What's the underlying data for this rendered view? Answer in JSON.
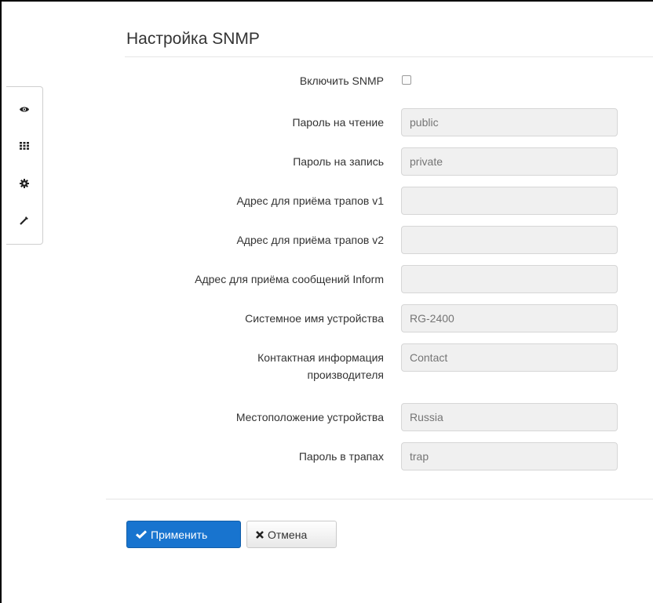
{
  "page": {
    "title": "Настройка SNMP"
  },
  "sidebar": {
    "icons": [
      "eye-icon",
      "grid-icon",
      "gear-icon",
      "wand-icon"
    ]
  },
  "form": {
    "enable_snmp": {
      "label": "Включить SNMP",
      "checked": false
    },
    "read_password": {
      "label": "Пароль на чтение",
      "value": "",
      "placeholder": "public"
    },
    "write_password": {
      "label": "Пароль на запись",
      "value": "",
      "placeholder": "private"
    },
    "trap_v1": {
      "label": "Адрес для приёма трапов v1",
      "value": "",
      "placeholder": ""
    },
    "trap_v2": {
      "label": "Адрес для приёма трапов v2",
      "value": "",
      "placeholder": ""
    },
    "inform": {
      "label": "Адрес для приёма сообщений Inform",
      "value": "",
      "placeholder": ""
    },
    "sys_name": {
      "label": "Системное имя устройства",
      "value": "",
      "placeholder": "RG-2400"
    },
    "contact": {
      "label": "Контактная информация производителя",
      "value": "",
      "placeholder": "Contact"
    },
    "location": {
      "label": "Местоположение устройства",
      "value": "",
      "placeholder": "Russia"
    },
    "trap_password": {
      "label": "Пароль в трапах",
      "value": "",
      "placeholder": "trap"
    }
  },
  "buttons": {
    "apply": "Применить",
    "cancel": "Отмена"
  },
  "colors": {
    "primary": "#1874cf",
    "field_bg": "#f0f0f0"
  }
}
